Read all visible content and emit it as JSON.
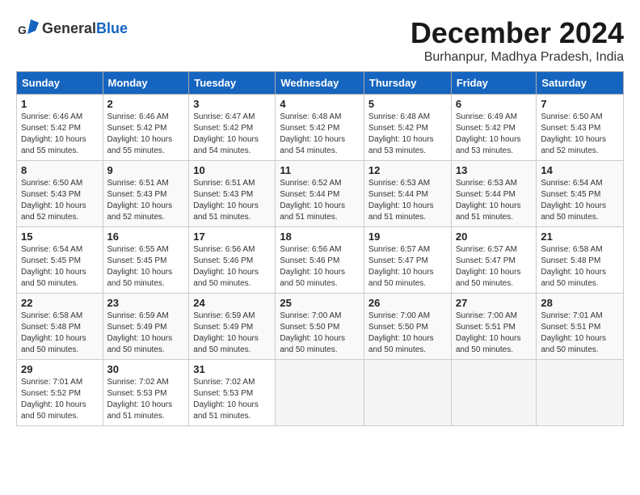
{
  "logo": {
    "general": "General",
    "blue": "Blue"
  },
  "title": "December 2024",
  "location": "Burhanpur, Madhya Pradesh, India",
  "days_of_week": [
    "Sunday",
    "Monday",
    "Tuesday",
    "Wednesday",
    "Thursday",
    "Friday",
    "Saturday"
  ],
  "weeks": [
    [
      {
        "day": "1",
        "info": "Sunrise: 6:46 AM\nSunset: 5:42 PM\nDaylight: 10 hours\nand 55 minutes."
      },
      {
        "day": "2",
        "info": "Sunrise: 6:46 AM\nSunset: 5:42 PM\nDaylight: 10 hours\nand 55 minutes."
      },
      {
        "day": "3",
        "info": "Sunrise: 6:47 AM\nSunset: 5:42 PM\nDaylight: 10 hours\nand 54 minutes."
      },
      {
        "day": "4",
        "info": "Sunrise: 6:48 AM\nSunset: 5:42 PM\nDaylight: 10 hours\nand 54 minutes."
      },
      {
        "day": "5",
        "info": "Sunrise: 6:48 AM\nSunset: 5:42 PM\nDaylight: 10 hours\nand 53 minutes."
      },
      {
        "day": "6",
        "info": "Sunrise: 6:49 AM\nSunset: 5:42 PM\nDaylight: 10 hours\nand 53 minutes."
      },
      {
        "day": "7",
        "info": "Sunrise: 6:50 AM\nSunset: 5:43 PM\nDaylight: 10 hours\nand 52 minutes."
      }
    ],
    [
      {
        "day": "8",
        "info": "Sunrise: 6:50 AM\nSunset: 5:43 PM\nDaylight: 10 hours\nand 52 minutes."
      },
      {
        "day": "9",
        "info": "Sunrise: 6:51 AM\nSunset: 5:43 PM\nDaylight: 10 hours\nand 52 minutes."
      },
      {
        "day": "10",
        "info": "Sunrise: 6:51 AM\nSunset: 5:43 PM\nDaylight: 10 hours\nand 51 minutes."
      },
      {
        "day": "11",
        "info": "Sunrise: 6:52 AM\nSunset: 5:44 PM\nDaylight: 10 hours\nand 51 minutes."
      },
      {
        "day": "12",
        "info": "Sunrise: 6:53 AM\nSunset: 5:44 PM\nDaylight: 10 hours\nand 51 minutes."
      },
      {
        "day": "13",
        "info": "Sunrise: 6:53 AM\nSunset: 5:44 PM\nDaylight: 10 hours\nand 51 minutes."
      },
      {
        "day": "14",
        "info": "Sunrise: 6:54 AM\nSunset: 5:45 PM\nDaylight: 10 hours\nand 50 minutes."
      }
    ],
    [
      {
        "day": "15",
        "info": "Sunrise: 6:54 AM\nSunset: 5:45 PM\nDaylight: 10 hours\nand 50 minutes."
      },
      {
        "day": "16",
        "info": "Sunrise: 6:55 AM\nSunset: 5:45 PM\nDaylight: 10 hours\nand 50 minutes."
      },
      {
        "day": "17",
        "info": "Sunrise: 6:56 AM\nSunset: 5:46 PM\nDaylight: 10 hours\nand 50 minutes."
      },
      {
        "day": "18",
        "info": "Sunrise: 6:56 AM\nSunset: 5:46 PM\nDaylight: 10 hours\nand 50 minutes."
      },
      {
        "day": "19",
        "info": "Sunrise: 6:57 AM\nSunset: 5:47 PM\nDaylight: 10 hours\nand 50 minutes."
      },
      {
        "day": "20",
        "info": "Sunrise: 6:57 AM\nSunset: 5:47 PM\nDaylight: 10 hours\nand 50 minutes."
      },
      {
        "day": "21",
        "info": "Sunrise: 6:58 AM\nSunset: 5:48 PM\nDaylight: 10 hours\nand 50 minutes."
      }
    ],
    [
      {
        "day": "22",
        "info": "Sunrise: 6:58 AM\nSunset: 5:48 PM\nDaylight: 10 hours\nand 50 minutes."
      },
      {
        "day": "23",
        "info": "Sunrise: 6:59 AM\nSunset: 5:49 PM\nDaylight: 10 hours\nand 50 minutes."
      },
      {
        "day": "24",
        "info": "Sunrise: 6:59 AM\nSunset: 5:49 PM\nDaylight: 10 hours\nand 50 minutes."
      },
      {
        "day": "25",
        "info": "Sunrise: 7:00 AM\nSunset: 5:50 PM\nDaylight: 10 hours\nand 50 minutes."
      },
      {
        "day": "26",
        "info": "Sunrise: 7:00 AM\nSunset: 5:50 PM\nDaylight: 10 hours\nand 50 minutes."
      },
      {
        "day": "27",
        "info": "Sunrise: 7:00 AM\nSunset: 5:51 PM\nDaylight: 10 hours\nand 50 minutes."
      },
      {
        "day": "28",
        "info": "Sunrise: 7:01 AM\nSunset: 5:51 PM\nDaylight: 10 hours\nand 50 minutes."
      }
    ],
    [
      {
        "day": "29",
        "info": "Sunrise: 7:01 AM\nSunset: 5:52 PM\nDaylight: 10 hours\nand 50 minutes."
      },
      {
        "day": "30",
        "info": "Sunrise: 7:02 AM\nSunset: 5:53 PM\nDaylight: 10 hours\nand 51 minutes."
      },
      {
        "day": "31",
        "info": "Sunrise: 7:02 AM\nSunset: 5:53 PM\nDaylight: 10 hours\nand 51 minutes."
      },
      {
        "day": "",
        "info": ""
      },
      {
        "day": "",
        "info": ""
      },
      {
        "day": "",
        "info": ""
      },
      {
        "day": "",
        "info": ""
      }
    ]
  ]
}
